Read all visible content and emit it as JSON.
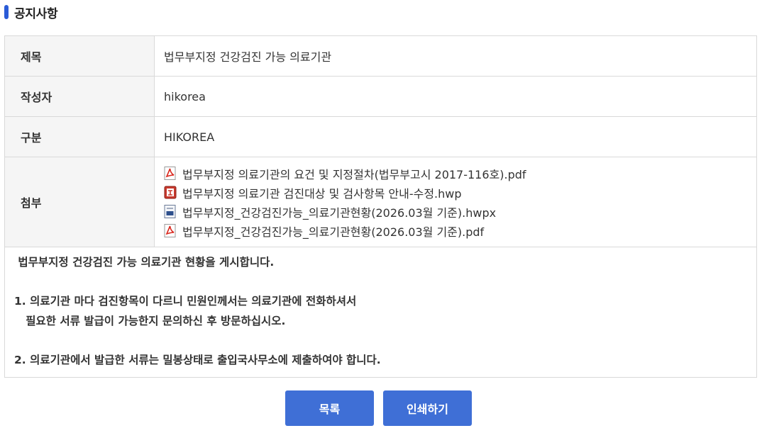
{
  "header": {
    "title": "공지사항"
  },
  "board": {
    "title_label": "제목",
    "title_value": "법무부지정 건강검진 가능 의료기관",
    "author_label": "작성자",
    "author_value": "hikorea",
    "category_label": "구분",
    "category_value": "HIKOREA",
    "attach_label": "첨부",
    "attachments": [
      {
        "name": "법무부지정 의료기관의 요건 및 지정절차(법무부고시 2017-116호).pdf",
        "icon": "pdf-icon"
      },
      {
        "name": "법무부지정 의료기관 검진대상 및 검사항목 안내-수정.hwp",
        "icon": "hwp-icon"
      },
      {
        "name": "법무부지정_건강검진가능_의료기관현황(2026.03월 기준).hwpx",
        "icon": "hwpx-icon"
      },
      {
        "name": "법무부지정_건강검진가능_의료기관현황(2026.03월 기준).pdf",
        "icon": "pdf-icon"
      }
    ],
    "content_lines": [
      " 법무부지정 건강검진 가능 의료기관 현황을 게시합니다.",
      "",
      "1. 의료기관 마다 검진항목이 다르니 민원인께서는 의료기관에 전화하셔서",
      "   필요한 서류 발급이 가능한지 문의하신 후 방문하십시오.",
      "",
      "2. 의료기관에서 발급한 서류는 밀봉상태로 출입국사무소에 제출하여야 합니다."
    ]
  },
  "buttons": {
    "list_label": "목록",
    "print_label": "인쇄하기"
  },
  "colors": {
    "accent": "#3f6fd6",
    "header_bar": "#2a5bd7",
    "pdf_red": "#d9261c"
  }
}
